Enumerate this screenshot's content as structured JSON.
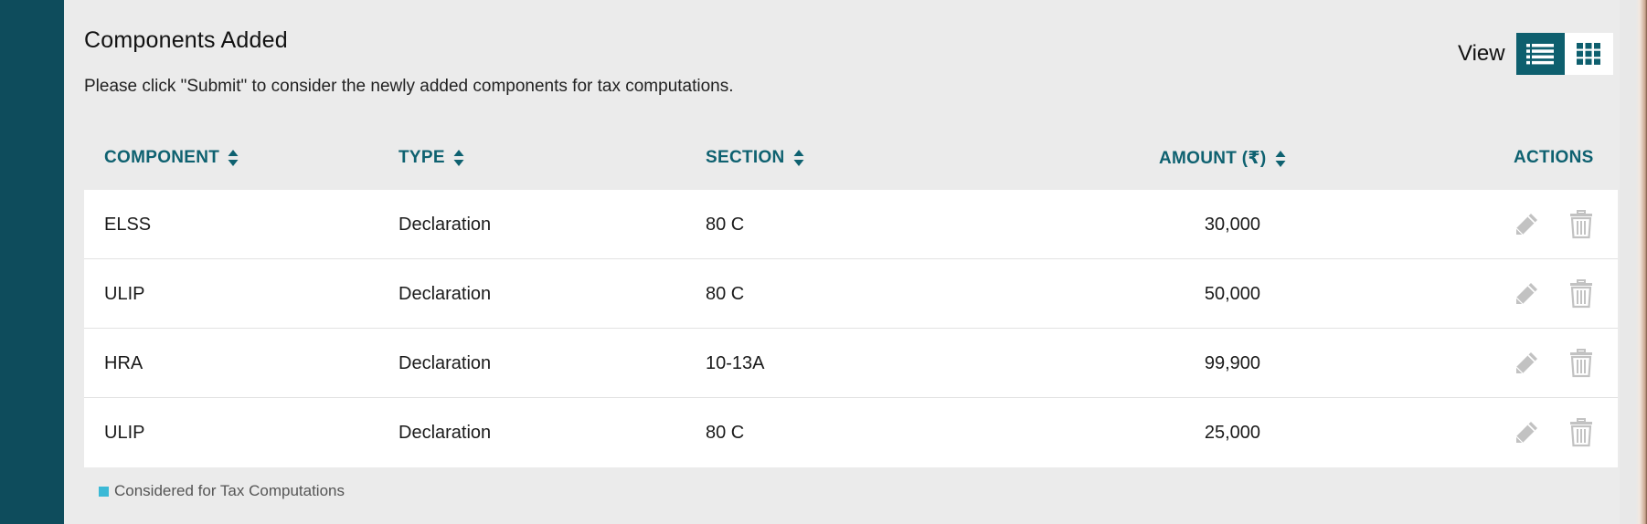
{
  "header": {
    "title": "Components Added",
    "subtitle": "Please click \"Submit\" to consider the newly added components for tax computations."
  },
  "view_toggle": {
    "label": "View",
    "active": "list",
    "options": [
      {
        "name": "list",
        "icon": "list-icon"
      },
      {
        "name": "grid",
        "icon": "grid-icon"
      }
    ],
    "accent_color": "#0e5f6e"
  },
  "table": {
    "columns": [
      "COMPONENT",
      "TYPE",
      "SECTION",
      "AMOUNT (₹)",
      "ACTIONS"
    ],
    "rows": [
      {
        "component": "ELSS",
        "type": "Declaration",
        "section": "80 C",
        "amount": "30,000"
      },
      {
        "component": "ULIP",
        "type": "Declaration",
        "section": "80 C",
        "amount": "50,000"
      },
      {
        "component": "HRA",
        "type": "Declaration",
        "section": "10-13A",
        "amount": "99,900"
      },
      {
        "component": "ULIP",
        "type": "Declaration",
        "section": "80 C",
        "amount": "25,000"
      }
    ],
    "row_actions": [
      "pencil-icon",
      "trash-icon"
    ]
  },
  "legend": {
    "label": "Considered for Tax Computations",
    "color": "#3bb9d6"
  }
}
